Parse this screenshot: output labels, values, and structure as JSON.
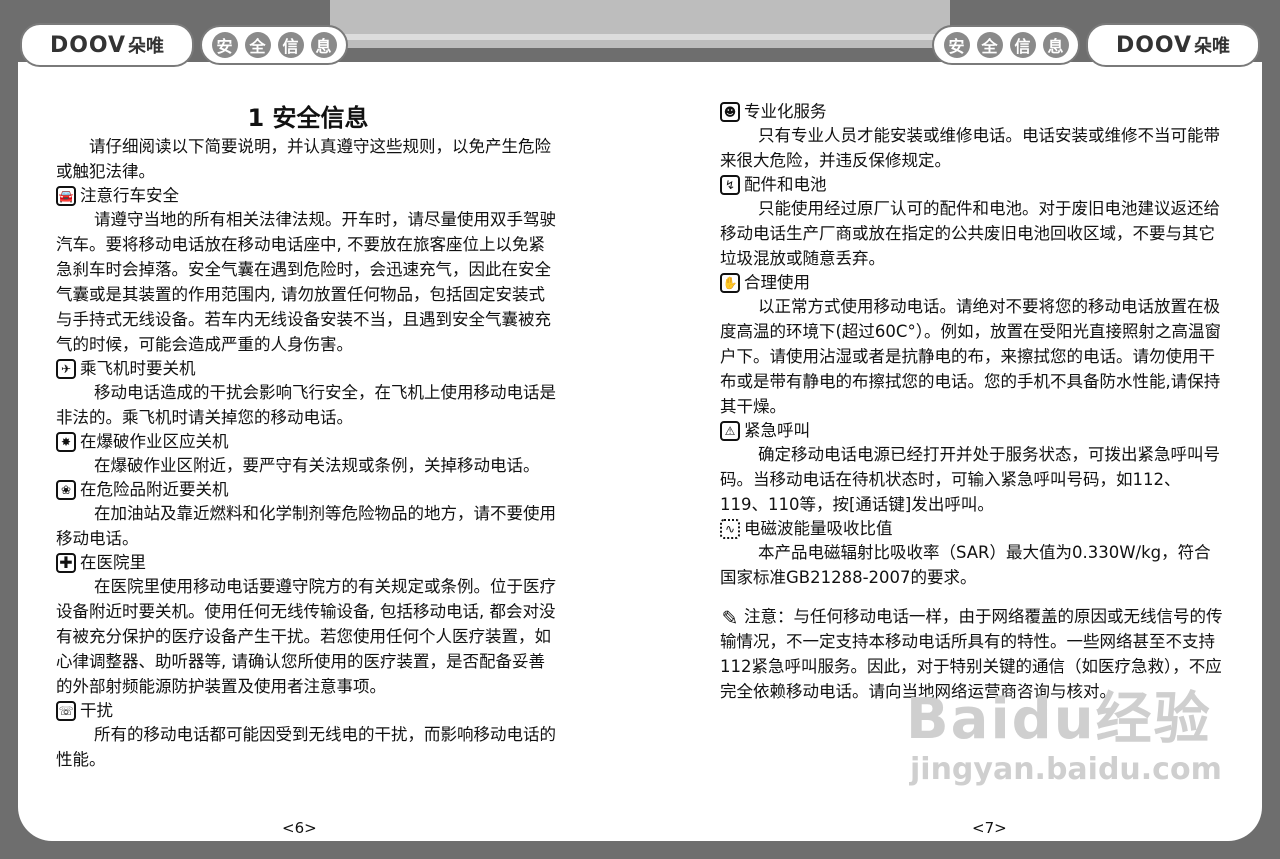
{
  "header": {
    "brand": "DOOV",
    "brand_sub": "朵唯",
    "section_chars": [
      "安",
      "全",
      "信",
      "息"
    ]
  },
  "left_page": {
    "title": "1   安全信息",
    "intro": "请仔细阅读以下简要说明，并认真遵守这些规则，以免产生危险或触犯法律。",
    "items": [
      {
        "icon": "car-icon",
        "heading": "注意行车安全",
        "body": "请遵守当地的所有相关法律法规。开车时，请尽量使用双手驾驶汽车。要将移动电话放在移动电话座中, 不要放在旅客座位上以免紧急刹车时会掉落。安全气囊在遇到危险时，会迅速充气，因此在安全气囊或是其装置的作用范围内, 请勿放置任何物品，包括固定安装式与手持式无线设备。若车内无线设备安装不当，且遇到安全气囊被充气的时候，可能会造成严重的人身伤害。"
      },
      {
        "icon": "airplane-icon",
        "heading": "乘飞机时要关机",
        "body": "移动电话造成的干扰会影响飞行安全，在飞机上使用移动电话是非法的。乘飞机时请关掉您的移动电话。"
      },
      {
        "icon": "blasting-icon",
        "heading": "在爆破作业区应关机",
        "body": "在爆破作业区附近，要严守有关法规或条例，关掉移动电话。"
      },
      {
        "icon": "hazard-icon",
        "heading": "在危险品附近要关机",
        "body": "在加油站及靠近燃料和化学制剂等危险物品的地方，请不要使用移动电话。"
      },
      {
        "icon": "hospital-cross-icon",
        "heading": "在医院里",
        "body": "在医院里使用移动电话要遵守院方的有关规定或条例。位于医疗设备附近时要关机。使用任何无线传输设备, 包括移动电话, 都会对没有被充分保护的医疗设备产生干扰。若您使用任何个人医疗装置，如心律调整器、助听器等, 请确认您所使用的医疗装置，是否配备妥善的外部射频能源防护装置及使用者注意事项。"
      },
      {
        "icon": "interference-icon",
        "heading": "干扰",
        "body": "所有的移动电话都可能因受到无线电的干扰，而影响移动电话的性能。"
      }
    ],
    "page_number": "<6>"
  },
  "right_page": {
    "items": [
      {
        "icon": "technician-icon",
        "heading": "专业化服务",
        "body": "只有专业人员才能安装或维修电话。电话安装或维修不当可能带来很大危险，并违反保修规定。"
      },
      {
        "icon": "charger-icon",
        "heading": "配件和电池",
        "body": "只能使用经过原厂认可的配件和电池。对于废旧电池建议返还给移动电话生产厂商或放在指定的公共废旧电池回收区域，不要与其它垃圾混放或随意丢弃。"
      },
      {
        "icon": "phone-hand-icon",
        "heading": "合理使用",
        "body": "以正常方式使用移动电话。请绝对不要将您的移动电话放置在极度高温的环境下(超过60C°）。例如，放置在受阳光直接照射之高温窗户下。请使用沾湿或者是抗静电的布，来擦拭您的电话。请勿使用干布或是带有静电的布擦拭您的电话。您的手机不具备防水性能,请保持其干燥。"
      },
      {
        "icon": "emergency-icon",
        "heading": "紧急呼叫",
        "body": "确定移动电话电源已经打开并处于服务状态，可拨出紧急呼叫号码。当移动电话在待机状态时，可输入紧急呼叫号码，如112、119、110等，按[通话键]发出呼叫。"
      },
      {
        "icon": "sar-icon",
        "heading": "电磁波能量吸收比值",
        "body": "本产品电磁辐射比吸收率（SAR）最大值为0.330W/kg，符合国家标准GB21288-2007的要求。"
      }
    ],
    "note": "注意：与任何移动电话一样，由于网络覆盖的原因或无线信号的传输情况，不一定支持本移动电话所具有的特性。一些网络甚至不支持112紧急呼叫服务。因此，对于特别关键的通信（如医疗急救），不应完全依赖移动电话。请向当地网络运营商咨询与核对。",
    "page_number": "<7>"
  },
  "watermark": {
    "line1": "Baidu经验",
    "line2": "jingyan.baidu.com"
  }
}
